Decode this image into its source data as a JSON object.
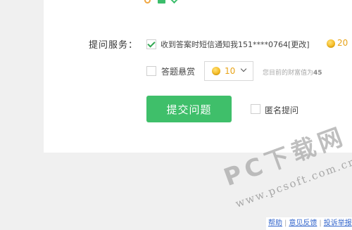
{
  "service": {
    "label": "提问服务：",
    "sms_label": "收到答案时短信通知我151****0764[更改]",
    "sms_coins": "20",
    "reward_label": "答题悬赏",
    "reward_value": "10",
    "wealth_prefix": "您目前的财富值为",
    "wealth_value": "45"
  },
  "submit": {
    "label": "提交问题"
  },
  "anonymous": {
    "label": "匿名提问"
  },
  "watermark": {
    "title": "PC下载网",
    "url": "www.pcsoft.com.cn"
  },
  "footer": {
    "links": [
      "帮助",
      "意见反馈",
      "投诉举报"
    ]
  },
  "colors": {
    "accent_green": "#3fbf6a",
    "coin_orange": "#e8a318"
  }
}
